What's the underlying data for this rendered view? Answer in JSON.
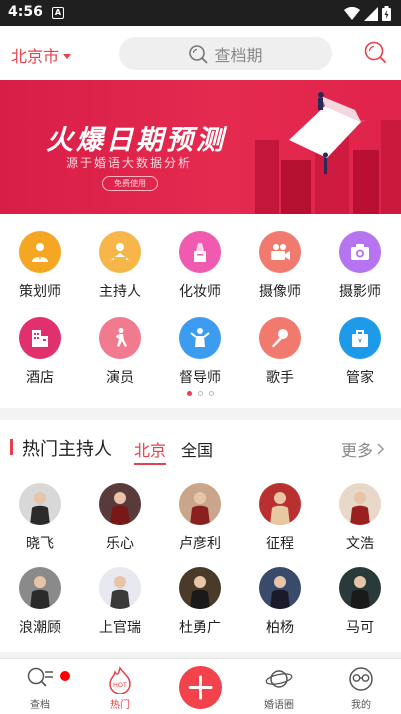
{
  "status_bar": {
    "time": "4:56",
    "notif_glyph": "A"
  },
  "header": {
    "city": "北京市",
    "search_placeholder": "查档期"
  },
  "banner": {
    "title": "火爆日期预测",
    "subtitle": "源于婚语大数据分析",
    "button": "免费使用"
  },
  "categories": [
    {
      "label": "策划师",
      "color": "#f5a623",
      "icon": "planner-icon"
    },
    {
      "label": "主持人",
      "color": "#f7b64a",
      "icon": "host-icon"
    },
    {
      "label": "化妆师",
      "color": "#f05bb0",
      "icon": "makeup-icon"
    },
    {
      "label": "摄像师",
      "color": "#f07a6e",
      "icon": "video-camera-icon"
    },
    {
      "label": "摄影师",
      "color": "#b774f0",
      "icon": "camera-icon"
    },
    {
      "label": "酒店",
      "color": "#e0306e",
      "icon": "hotel-icon"
    },
    {
      "label": "演员",
      "color": "#f27a8e",
      "icon": "actor-icon"
    },
    {
      "label": "督导师",
      "color": "#3d9cf0",
      "icon": "supervisor-icon"
    },
    {
      "label": "歌手",
      "color": "#f07a6e",
      "icon": "microphone-icon"
    },
    {
      "label": "管家",
      "color": "#1e9be8",
      "icon": "butler-icon"
    }
  ],
  "hosts": {
    "title": "热门主持人",
    "tabs": [
      "北京",
      "全国"
    ],
    "more": "更多",
    "people": [
      {
        "name": "晓飞",
        "bg": "#d8d8d8",
        "fg": "#2a2a2a"
      },
      {
        "name": "乐心",
        "bg": "#5a3b3b",
        "fg": "#7a1818"
      },
      {
        "name": "卢彦利",
        "bg": "#c9a58a",
        "fg": "#8a2020"
      },
      {
        "name": "征程",
        "bg": "#b83030",
        "fg": "#e8c8a0"
      },
      {
        "name": "文浩",
        "bg": "#e8d8c8",
        "fg": "#9a2020"
      },
      {
        "name": "浪潮顾",
        "bg": "#8a8a8a",
        "fg": "#2a2a2a"
      },
      {
        "name": "上官瑞",
        "bg": "#e8e8f0",
        "fg": "#3a3a3a"
      },
      {
        "name": "杜勇广",
        "bg": "#4a3a2a",
        "fg": "#1a1a1a"
      },
      {
        "name": "柏杨",
        "bg": "#3a4a6a",
        "fg": "#1a1a2a"
      },
      {
        "name": "马可",
        "bg": "#2a3a3a",
        "fg": "#1a1a1a"
      }
    ]
  },
  "nav": [
    {
      "label": "查档",
      "icon": "schedule-search-icon"
    },
    {
      "label": "热门",
      "icon": "hot-icon"
    },
    {
      "label": "",
      "icon": "plus-icon"
    },
    {
      "label": "婚语圈",
      "icon": "planet-icon"
    },
    {
      "label": "我的",
      "icon": "profile-glasses-icon"
    }
  ]
}
